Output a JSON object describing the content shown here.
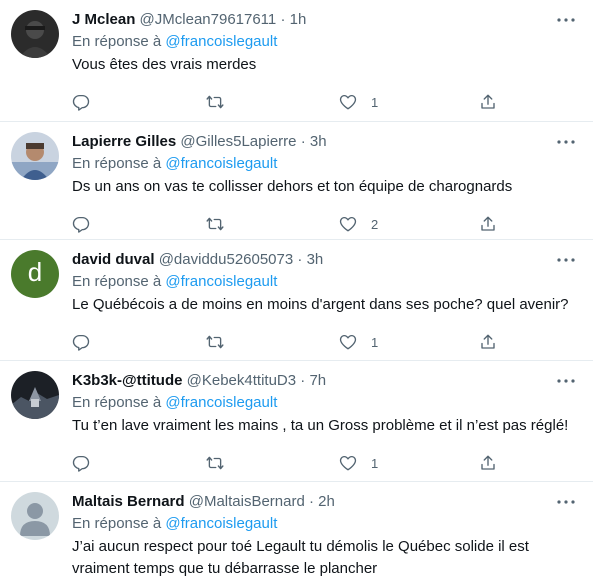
{
  "reply_prefix": "En réponse à",
  "tweets": [
    {
      "name": "J Mclean",
      "handle": "@JMclean79617611",
      "sep": "·",
      "time": "1h",
      "mention": "@francoislegault",
      "text": "Vous êtes des vrais merdes",
      "likes": "1",
      "avatar": "dark-photo"
    },
    {
      "name": "Lapierre Gilles",
      "handle": "@Gilles5Lapierre",
      "sep": "·",
      "time": "3h",
      "mention": "@francoislegault",
      "text": "Ds un ans on vas te collisser dehors et ton équipe de charognards",
      "likes": "2",
      "avatar": "person-photo"
    },
    {
      "name": "david duval",
      "handle": "@daviddu52605073",
      "sep": "·",
      "time": "3h",
      "mention": "@francoislegault",
      "text": "Le Québécois a de moins en moins d'argent dans ses poche? quel avenir?",
      "likes": "1",
      "avatar": "letter-d",
      "avatar_letter": "d",
      "avatar_color": "#4a7a2c"
    },
    {
      "name": "K3b3k-@ttitude",
      "handle": "@Kebek4ttituD3",
      "sep": "·",
      "time": "7h",
      "mention": "@francoislegault",
      "text": "Tu t’en lave vraiment les mains , ta un Gross problème et il n’est pas réglé!",
      "likes": "1",
      "avatar": "dark-landscape"
    },
    {
      "name": "Maltais Bernard",
      "handle": "@MaltaisBernard",
      "sep": "·",
      "time": "2h",
      "mention": "@francoislegault",
      "text": "J’ai aucun respect pour toé Legault tu démolis le Québec solide il est vraiment temps que tu débarrasse le plancher",
      "likes": "",
      "avatar": "default-avatar"
    }
  ],
  "colors": {
    "text": "#0f1419",
    "muted": "#536471",
    "link": "#1d9bf0",
    "border": "#e6ecf0"
  }
}
